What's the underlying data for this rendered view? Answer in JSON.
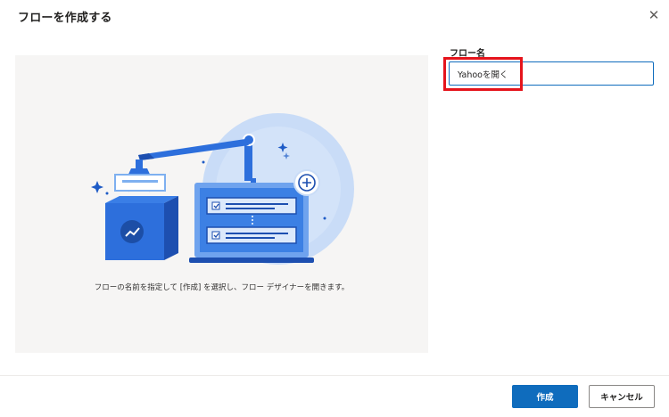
{
  "dialog": {
    "title": "フローを作成する",
    "close_icon": "close-icon",
    "illustration": {
      "caption": "フローの名前を指定して [作成] を選択し、フロー デザイナーを開きます。"
    },
    "form": {
      "name_label": "フロー名",
      "name_value": "Yahooを開く"
    },
    "buttons": {
      "create": "作成",
      "cancel": "キャンセル"
    }
  },
  "colors": {
    "primary": "#0f6cbd",
    "highlight": "#e5141c",
    "illustration_blue": "#2d6fdc",
    "panel_bg": "#f6f5f4"
  }
}
